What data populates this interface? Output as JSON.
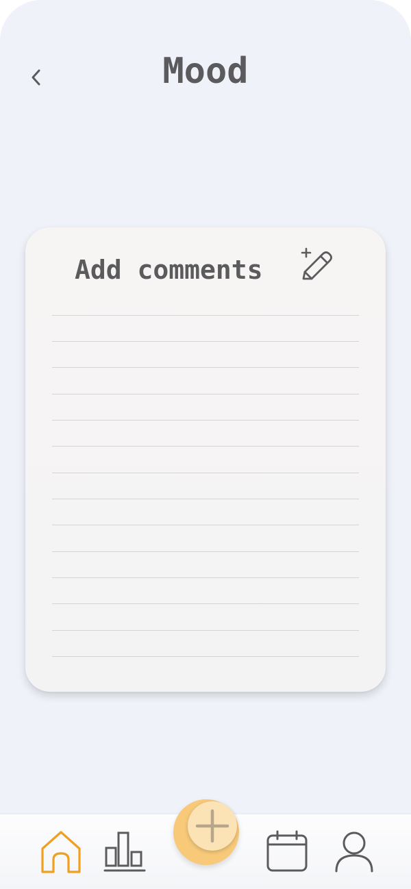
{
  "header": {
    "title": "Mood",
    "back_icon": "chevron-left-icon"
  },
  "comments_card": {
    "title": "Add comments",
    "edit_icon": "pencil-sparkle-icon",
    "line_count": 14
  },
  "bottom_nav": {
    "items": [
      {
        "icon": "home-icon",
        "active": true
      },
      {
        "icon": "bar-chart-icon",
        "active": false
      },
      {
        "icon": "plus-icon",
        "active": false
      },
      {
        "icon": "calendar-icon",
        "active": false
      },
      {
        "icon": "user-icon",
        "active": false
      }
    ]
  },
  "colors": {
    "background": "#eff2f9",
    "text": "#5b5b5e",
    "accent": "#f0a020",
    "fab_outer": "#f7c979",
    "fab_inner": "#fbe3b6",
    "rule_line": "#d4d4d6"
  }
}
